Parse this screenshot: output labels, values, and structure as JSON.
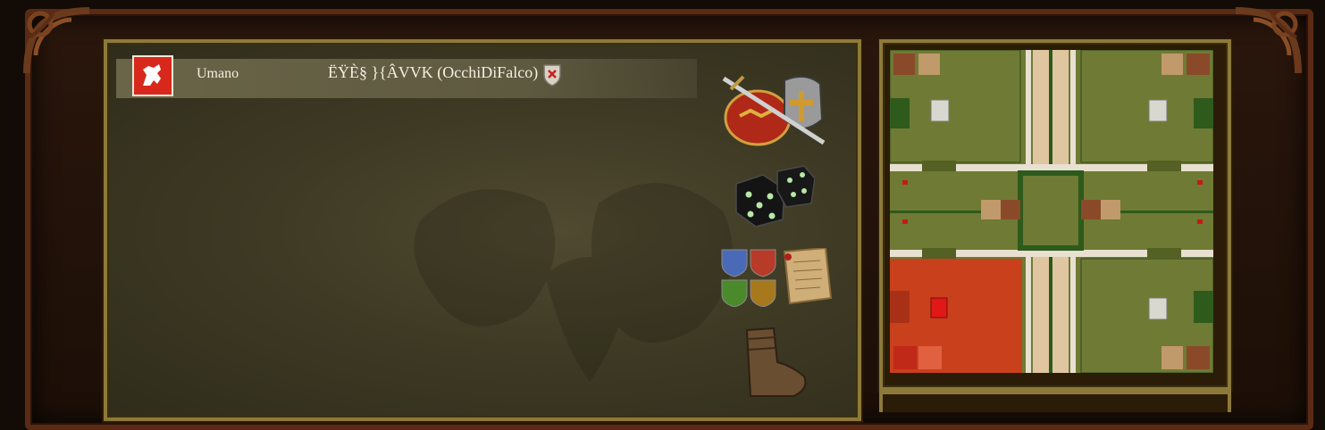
{
  "player": {
    "type_label": "Umano",
    "name": "ËŸÈ§ }{ÂVVK (OcchiDiFalco)",
    "crest_color": "#d8281c"
  },
  "side_icons": [
    {
      "name": "sword-helmet-icon",
      "meaning": "combat"
    },
    {
      "name": "dice-icon",
      "meaning": "dice"
    },
    {
      "name": "faction-shields-icon",
      "meaning": "factions"
    },
    {
      "name": "boot-icon",
      "meaning": "movement"
    }
  ],
  "minimap": {
    "territory_colors": {
      "grass": "#6f7a34",
      "player_red": "#c8401c",
      "road": "#e8d2b0",
      "border_green": "#2e5a1c"
    }
  },
  "colors": {
    "frame_gold": "#8d7a3a",
    "panel_bg": "#3e3a24",
    "wood": "#5a2a14"
  }
}
